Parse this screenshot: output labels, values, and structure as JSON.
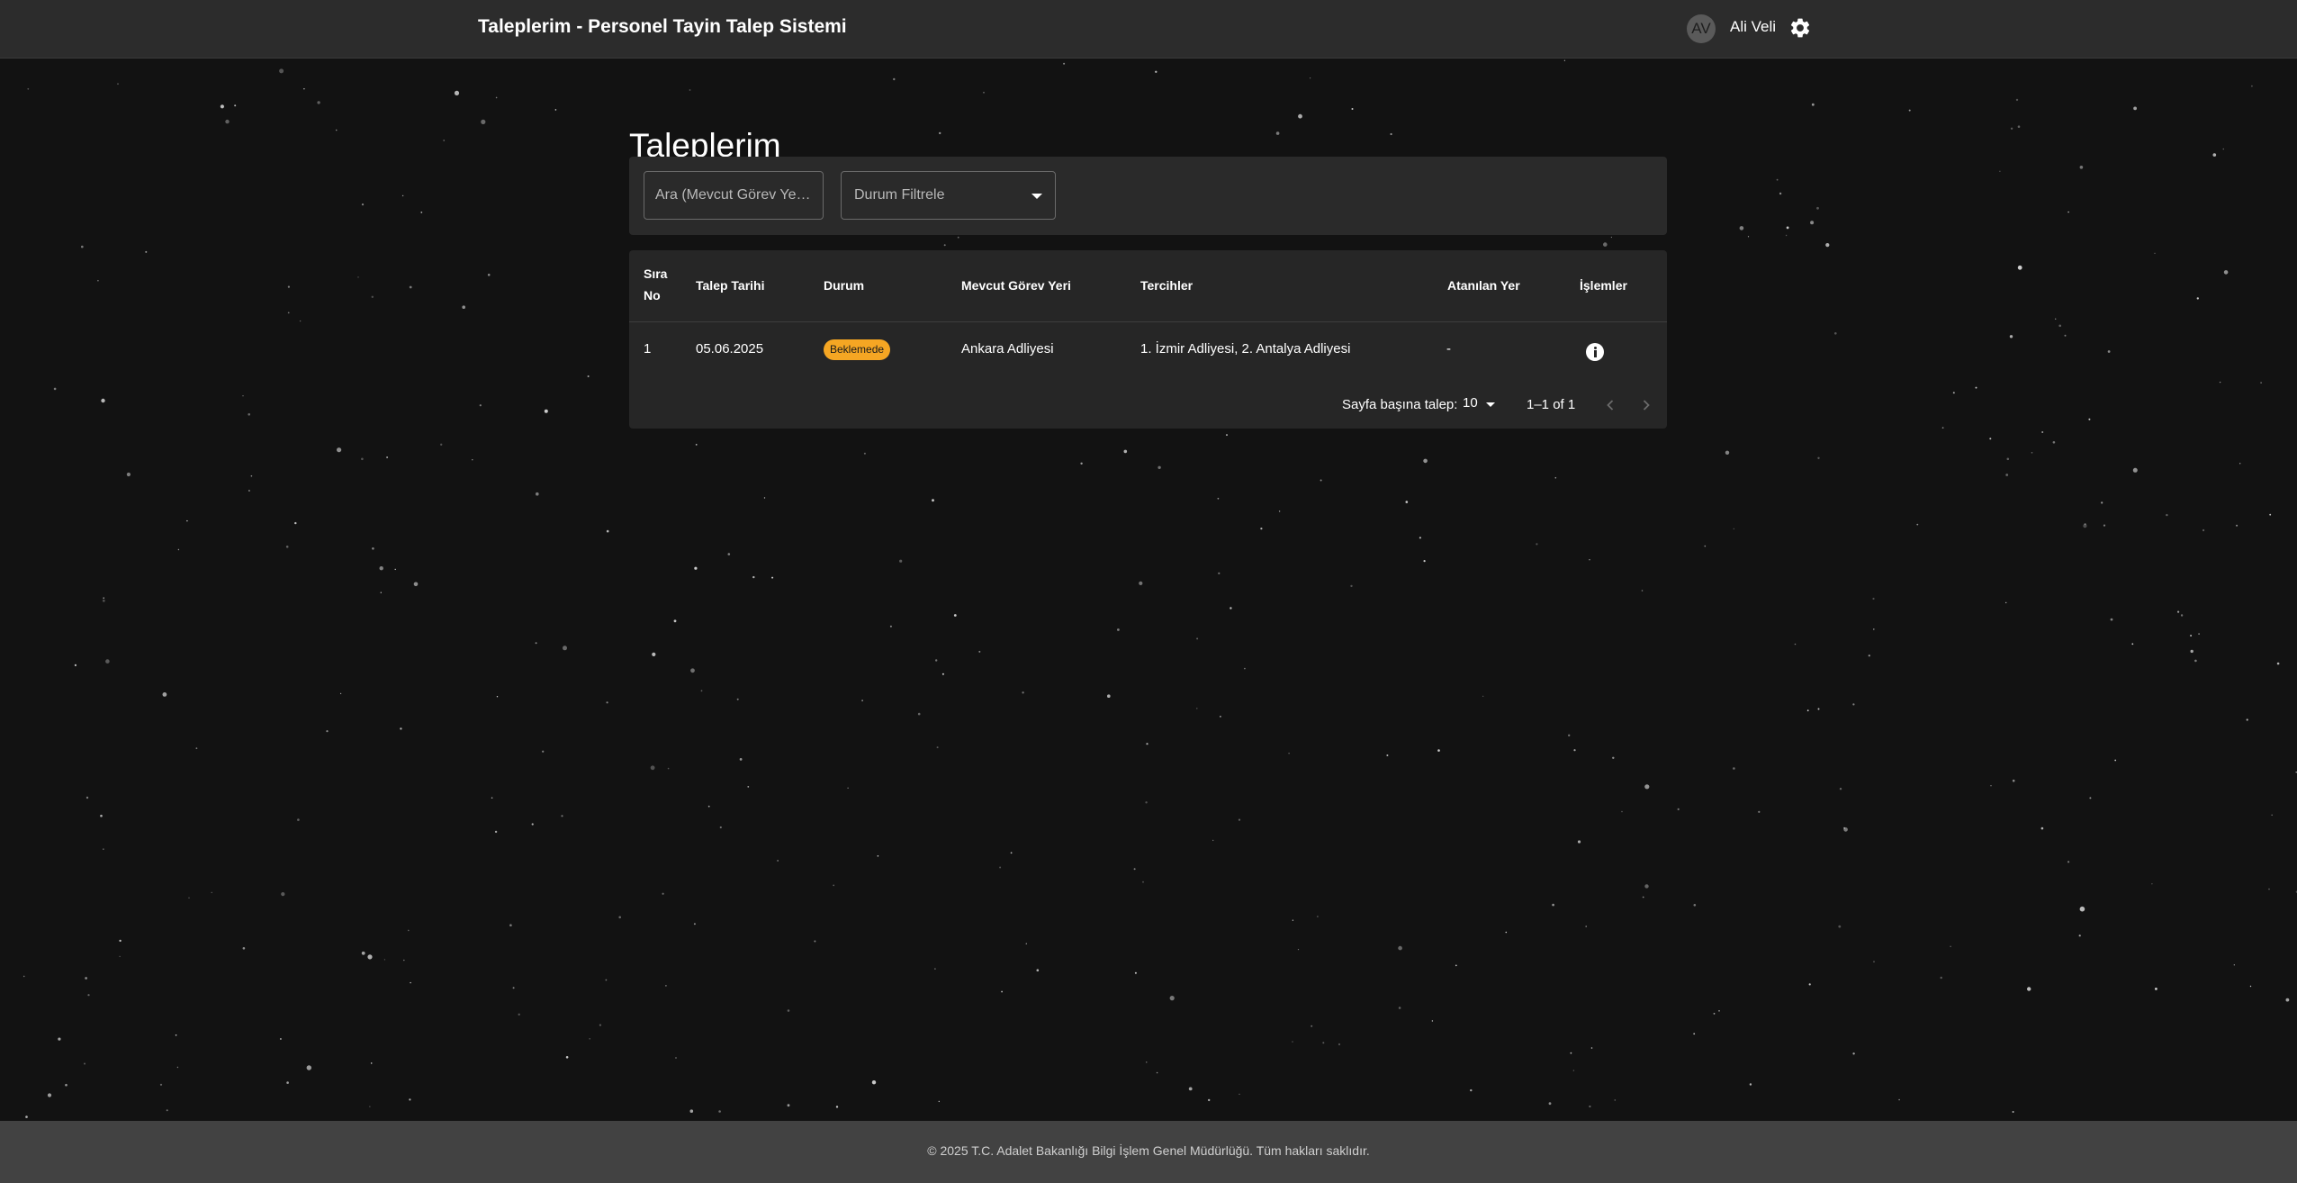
{
  "app_bar": {
    "title": "Taleplerim - Personel Tayin Talep Sistemi",
    "avatar_initials": "AV",
    "user_name": "Ali Veli",
    "settings_icon": "gear-icon"
  },
  "page": {
    "title": "Taleplerim"
  },
  "filters": {
    "search_placeholder": "Ara (Mevcut Görev Yeri,...",
    "status_filter_label": "Durum Filtrele"
  },
  "table": {
    "headers": {
      "sira_no_line1": "Sıra",
      "sira_no_line2": "No",
      "talep_tarihi": "Talep Tarihi",
      "durum": "Durum",
      "mevcut_gorev_yeri": "Mevcut Görev Yeri",
      "tercihler": "Tercihler",
      "atanan_yer": "Atanılan Yer",
      "islemler": "İşlemler"
    },
    "rows": [
      {
        "sira_no": "1",
        "talep_tarihi": "05.06.2025",
        "durum": "Beklemede",
        "mevcut_gorev_yeri": "Ankara Adliyesi",
        "tercihler": "1. İzmir Adliyesi, 2. Antalya Adliyesi",
        "atanan_yer": "-",
        "action_icon": "info-icon"
      }
    ],
    "pagination": {
      "rows_per_page_label": "Sayfa başına talep:",
      "rows_per_page_value": "10",
      "range_text": "1–1 of 1"
    }
  },
  "footer": {
    "text": "© 2025 T.C. Adalet Bakanlığı Bilgi İşlem Genel Müdürlüğü. Tüm hakları saklıdır."
  },
  "colors": {
    "background": "#121212",
    "app_bar": "#2c2c2c",
    "card": "#262626",
    "badge_pending": "#f5a623",
    "footer": "#424242"
  }
}
